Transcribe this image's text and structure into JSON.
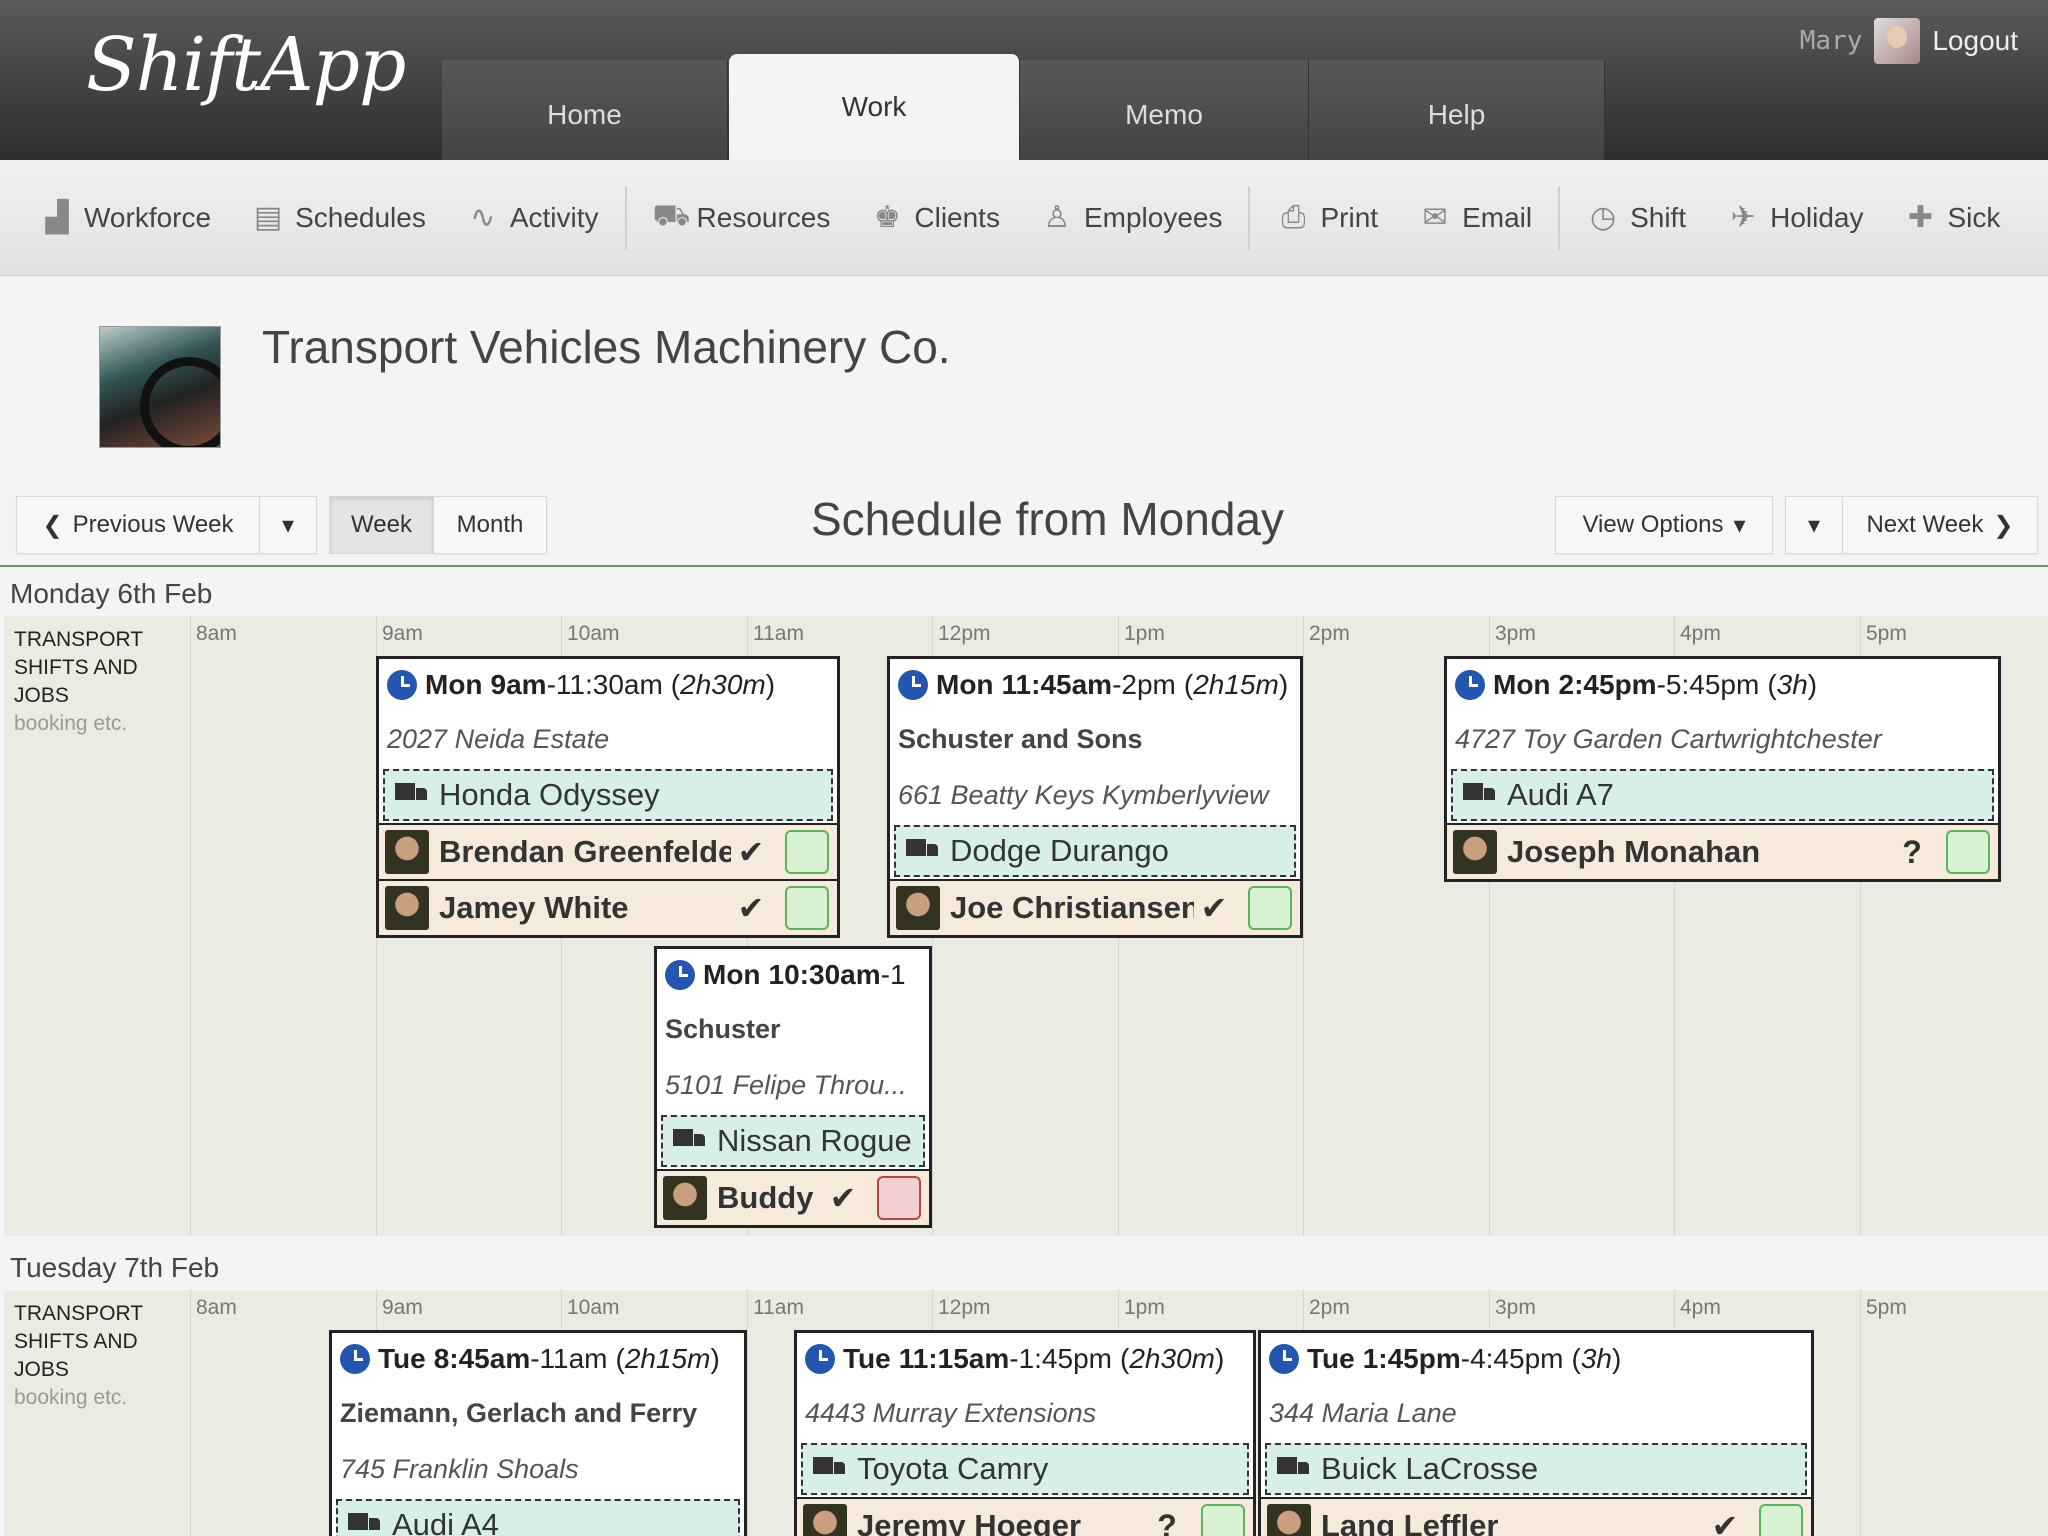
{
  "app": {
    "logo": "ShiftApp",
    "user": "Mary",
    "logout": "Logout"
  },
  "tabs": [
    {
      "label": "Home"
    },
    {
      "label": "Work"
    },
    {
      "label": "Memo"
    },
    {
      "label": "Help"
    }
  ],
  "toolbar": [
    {
      "label": "Workforce",
      "icon": "factory-icon"
    },
    {
      "label": "Schedules",
      "icon": "clipboard-icon"
    },
    {
      "label": "Activity",
      "icon": "pulse-icon"
    },
    {
      "label": "Resources",
      "icon": "truck-icon"
    },
    {
      "label": "Clients",
      "icon": "client-icon"
    },
    {
      "label": "Employees",
      "icon": "user-icon"
    },
    {
      "label": "Print",
      "icon": "printer-icon"
    },
    {
      "label": "Email",
      "icon": "envelope-icon"
    },
    {
      "label": "Shift",
      "icon": "clock-icon"
    },
    {
      "label": "Holiday",
      "icon": "plane-icon"
    },
    {
      "label": "Sick",
      "icon": "medkit-icon"
    }
  ],
  "company": {
    "name": "Transport Vehicles Machinery Co."
  },
  "nav": {
    "prev": "Previous Week",
    "week": "Week",
    "month": "Month",
    "title": "Schedule from Monday",
    "view_options": "View Options",
    "next": "Next Week"
  },
  "hours": [
    "8am",
    "9am",
    "10am",
    "11am",
    "12pm",
    "1pm",
    "2pm",
    "3pm",
    "4pm",
    "5pm"
  ],
  "row_label": {
    "title": "TRANSPORT SHIFTS AND JOBS",
    "sub": "booking etc."
  },
  "colors": {
    "clock": "#2356b0",
    "vehicle_bg": "#d8efe9",
    "staff_bg": "#f5eadc",
    "confirm_green": "#5bb55b",
    "reject_red": "#b44444",
    "grid_bg": "#ecebe1"
  },
  "days": [
    {
      "label": "Monday 6th Feb",
      "shifts": [
        {
          "day": "Mon",
          "start": "9am",
          "end": "11:30am",
          "dur": "2h30m",
          "client": "",
          "address": "2027 Neida Estate",
          "vehicle": "Honda Odyssey",
          "staff": [
            {
              "name": "Brendan Greenfelder",
              "mark": "✔",
              "status": "green"
            },
            {
              "name": "Jamey White",
              "mark": "✔",
              "status": "green"
            }
          ]
        },
        {
          "day": "Mon",
          "start": "11:45am",
          "end": "2pm",
          "dur": "2h15m",
          "client": "Schuster and Sons",
          "address": "661 Beatty Keys Kymberlyview",
          "vehicle": "Dodge Durango",
          "staff": [
            {
              "name": "Joe Christiansen",
              "mark": "✔",
              "status": "green"
            }
          ]
        },
        {
          "day": "Mon",
          "start": "2:45pm",
          "end": "5:45pm",
          "dur": "3h",
          "client": "",
          "address": "4727 Toy Garden Cartwrightchester",
          "vehicle": "Audi A7",
          "staff": [
            {
              "name": "Joseph Monahan",
              "mark": "?",
              "status": "green"
            }
          ]
        },
        {
          "day": "Mon",
          "start": "10:30am",
          "end": "1",
          "dur": "",
          "client": "Schuster",
          "address": "5101 Felipe Throu...",
          "vehicle": "Nissan Rogue",
          "staff": [
            {
              "name": "Buddy Brown",
              "mark": "✔",
              "status": "red"
            }
          ]
        }
      ]
    },
    {
      "label": "Tuesday 7th Feb",
      "shifts": [
        {
          "day": "Tue",
          "start": "8:45am",
          "end": "11am",
          "dur": "2h15m",
          "client": "Ziemann, Gerlach and Ferry",
          "address": "745 Franklin Shoals",
          "vehicle": "Audi A4",
          "staff": []
        },
        {
          "day": "Tue",
          "start": "11:15am",
          "end": "1:45pm",
          "dur": "2h30m",
          "client": "",
          "address": "4443 Murray Extensions",
          "vehicle": "Toyota Camry",
          "staff": [
            {
              "name": "Jeremy Hoeger",
              "mark": "?",
              "status": "green"
            }
          ]
        },
        {
          "day": "Tue",
          "start": "1:45pm",
          "end": "4:45pm",
          "dur": "3h",
          "client": "",
          "address": "344 Maria Lane",
          "vehicle": "Buick LaCrosse",
          "staff": [
            {
              "name": "Lang Leffler",
              "mark": "✔",
              "status": "green"
            }
          ]
        }
      ]
    }
  ]
}
